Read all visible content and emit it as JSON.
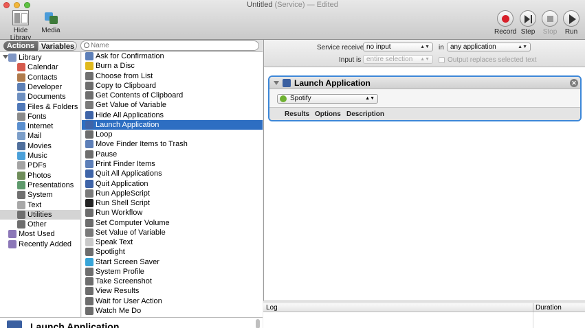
{
  "window": {
    "title": "Untitled",
    "title_kind": "(Service)",
    "title_status": "— Edited"
  },
  "toolbar": {
    "hide_library": "Hide Library",
    "media": "Media",
    "record": "Record",
    "step": "Step",
    "stop": "Stop",
    "run": "Run"
  },
  "tabs": {
    "actions": "Actions",
    "variables": "Variables"
  },
  "search": {
    "placeholder": "Name",
    "value": ""
  },
  "library": {
    "items": [
      {
        "label": "Library",
        "icon": "library-icon",
        "color": "#7f96c4"
      },
      {
        "label": "Calendar",
        "icon": "calendar-icon",
        "color": "#d65a4c"
      },
      {
        "label": "Contacts",
        "icon": "contacts-icon",
        "color": "#b07b4b"
      },
      {
        "label": "Developer",
        "icon": "developer-icon",
        "color": "#5c7fb5"
      },
      {
        "label": "Documents",
        "icon": "documents-icon",
        "color": "#6d8fc0"
      },
      {
        "label": "Files & Folders",
        "icon": "folder-icon",
        "color": "#4f78b8"
      },
      {
        "label": "Fonts",
        "icon": "fonts-icon",
        "color": "#8a8a8a"
      },
      {
        "label": "Internet",
        "icon": "internet-icon",
        "color": "#5a8fcf"
      },
      {
        "label": "Mail",
        "icon": "mail-icon",
        "color": "#7b9ec9"
      },
      {
        "label": "Movies",
        "icon": "movies-icon",
        "color": "#4f6f9c"
      },
      {
        "label": "Music",
        "icon": "music-icon",
        "color": "#4aa0d9"
      },
      {
        "label": "PDFs",
        "icon": "pdf-icon",
        "color": "#a4a4a4"
      },
      {
        "label": "Photos",
        "icon": "photos-icon",
        "color": "#6f8d5a"
      },
      {
        "label": "Presentations",
        "icon": "presentations-icon",
        "color": "#5e9a6c"
      },
      {
        "label": "System",
        "icon": "system-icon",
        "color": "#707070"
      },
      {
        "label": "Text",
        "icon": "text-icon",
        "color": "#a8a8a8"
      },
      {
        "label": "Utilities",
        "icon": "utilities-icon",
        "color": "#6e6e6e"
      },
      {
        "label": "Other",
        "icon": "other-icon",
        "color": "#6e6e6e"
      },
      {
        "label": "Most Used",
        "icon": "most-used-folder-icon",
        "color": "#8c78b8"
      },
      {
        "label": "Recently Added",
        "icon": "recently-added-folder-icon",
        "color": "#8c78b8"
      }
    ],
    "selected": "Utilities"
  },
  "actions": {
    "items": [
      {
        "label": "Ask for Confirmation",
        "icon": "confirm-icon",
        "color": "#5d7fb8"
      },
      {
        "label": "Burn a Disc",
        "icon": "burn-disc-icon",
        "color": "#e0b91c"
      },
      {
        "label": "Choose from List",
        "icon": "list-icon",
        "color": "#6f6f6f"
      },
      {
        "label": "Copy to Clipboard",
        "icon": "clipboard-icon",
        "color": "#6e6e6e"
      },
      {
        "label": "Get Contents of Clipboard",
        "icon": "clipboard-icon",
        "color": "#6e6e6e"
      },
      {
        "label": "Get Value of Variable",
        "icon": "variable-icon",
        "color": "#7a7a7a"
      },
      {
        "label": "Hide All Applications",
        "icon": "apps-icon",
        "color": "#3e64a8"
      },
      {
        "label": "Launch Application",
        "icon": "launch-app-icon",
        "color": "#3e64a8"
      },
      {
        "label": "Loop",
        "icon": "loop-icon",
        "color": "#6d6d6d"
      },
      {
        "label": "Move Finder Items to Trash",
        "icon": "trash-icon",
        "color": "#5d7fb8"
      },
      {
        "label": "Pause",
        "icon": "pause-icon",
        "color": "#6d6d6d"
      },
      {
        "label": "Print Finder Items",
        "icon": "print-icon",
        "color": "#5d7fb8"
      },
      {
        "label": "Quit All Applications",
        "icon": "apps-icon",
        "color": "#3e64a8"
      },
      {
        "label": "Quit Application",
        "icon": "apps-icon",
        "color": "#3e64a8"
      },
      {
        "label": "Run AppleScript",
        "icon": "applescript-icon",
        "color": "#7a7a7a"
      },
      {
        "label": "Run Shell Script",
        "icon": "terminal-icon",
        "color": "#222222"
      },
      {
        "label": "Run Workflow",
        "icon": "workflow-icon",
        "color": "#6d6d6d"
      },
      {
        "label": "Set Computer Volume",
        "icon": "volume-icon",
        "color": "#6d6d6d"
      },
      {
        "label": "Set Value of Variable",
        "icon": "variable-icon",
        "color": "#7a7a7a"
      },
      {
        "label": "Speak Text",
        "icon": "speak-icon",
        "color": "#c9c9c9"
      },
      {
        "label": "Spotlight",
        "icon": "spotlight-icon",
        "color": "#6d6d6d"
      },
      {
        "label": "Start Screen Saver",
        "icon": "screensaver-icon",
        "color": "#38a5d8"
      },
      {
        "label": "System Profile",
        "icon": "system-profile-icon",
        "color": "#6d6d6d"
      },
      {
        "label": "Take Screenshot",
        "icon": "screenshot-icon",
        "color": "#6d6d6d"
      },
      {
        "label": "View Results",
        "icon": "results-icon",
        "color": "#6d6d6d"
      },
      {
        "label": "Wait for User Action",
        "icon": "wait-icon",
        "color": "#6d6d6d"
      },
      {
        "label": "Watch Me Do",
        "icon": "watch-me-do-icon",
        "color": "#6d6d6d"
      }
    ],
    "selected": "Launch Application"
  },
  "description": {
    "title": "Launch Application"
  },
  "service": {
    "receives_label": "Service receives",
    "receives_value": "no input",
    "in_label": "in",
    "in_value": "any application",
    "input_is_label": "Input is",
    "input_is_value": "entire selection",
    "replace_label": "Output replaces selected text"
  },
  "card": {
    "title": "Launch Application",
    "app_value": "Spotify",
    "tabs": [
      "Results",
      "Options",
      "Description"
    ]
  },
  "log": {
    "col_log": "Log",
    "col_duration": "Duration"
  },
  "colors": {
    "accent": "#2d6ec2",
    "card_border": "#3c87d8",
    "record": "#d8202a",
    "spotify": "#6fb132"
  }
}
